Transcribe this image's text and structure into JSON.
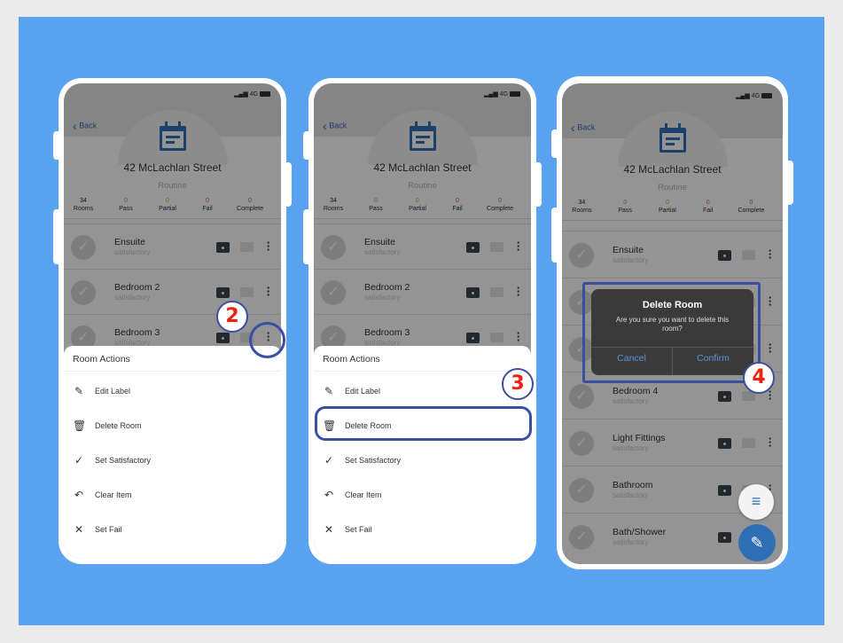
{
  "colors": {
    "background": "#58a2f0",
    "accent": "#2f6fb5",
    "highlight": "#3a4fa0",
    "badge_text": "#e21b1b"
  },
  "status": {
    "signal": "4G"
  },
  "header": {
    "back": "Back",
    "title": "42 McLachlan Street",
    "subtitle": "Routine",
    "icon": "calendar-icon"
  },
  "stats": [
    {
      "value": "34",
      "label": "Rooms",
      "color": "#222222"
    },
    {
      "value": "0",
      "label": "Pass",
      "color": "#6bbf59"
    },
    {
      "value": "0",
      "label": "Partial",
      "color": "#e0a030"
    },
    {
      "value": "0",
      "label": "Fail",
      "color": "#e05a4a"
    },
    {
      "value": "0",
      "label": "Complete",
      "color": "#4a90d9"
    }
  ],
  "rooms": [
    {
      "name": "Ensuite",
      "status": "satisfactory"
    },
    {
      "name": "Bedroom 2",
      "status": "satisfactory"
    },
    {
      "name": "Bedroom 3",
      "status": "satisfactory"
    },
    {
      "name": "Bedroom 4",
      "status": "satisfactory"
    },
    {
      "name": "Light Fittings",
      "status": "satisfactory"
    },
    {
      "name": "Bathroom",
      "status": "satisfactory"
    },
    {
      "name": "Bath/Shower",
      "status": "satisfactory"
    }
  ],
  "sheet": {
    "title": "Room Actions",
    "actions": [
      {
        "label": "Edit Label",
        "icon": "pencil-icon"
      },
      {
        "label": "Delete Room",
        "icon": "trash-icon"
      },
      {
        "label": "Set Satisfactory",
        "icon": "check-icon"
      },
      {
        "label": "Clear Item",
        "icon": "undo-icon"
      },
      {
        "label": "Set Fail",
        "icon": "close-icon"
      }
    ]
  },
  "dialog": {
    "title": "Delete Room",
    "message": "Are you sure you want to delete this room?",
    "cancel": "Cancel",
    "confirm": "Confirm"
  },
  "steps": [
    "2",
    "3",
    "4"
  ]
}
